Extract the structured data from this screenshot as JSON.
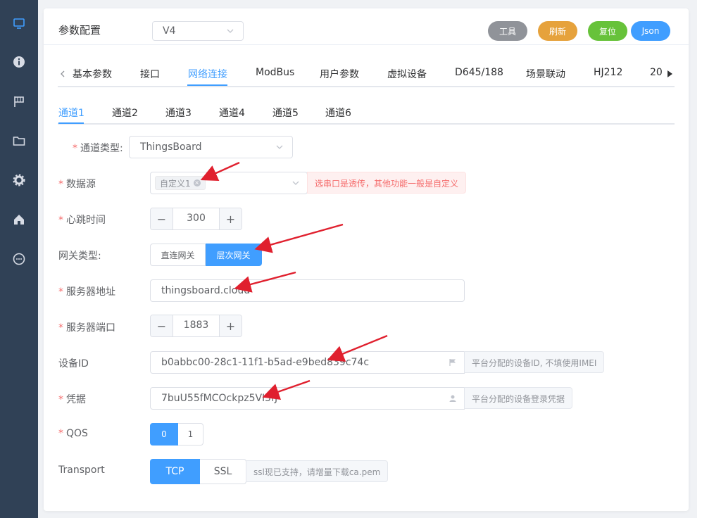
{
  "header": {
    "title": "参数配置",
    "version": "V4",
    "buttons": {
      "tools": "工具",
      "refresh": "刷新",
      "reset": "复位",
      "json": "Json"
    }
  },
  "main_tabs": [
    "基本参数",
    "接口",
    "网络连接",
    "ModBus",
    "用户参数",
    "虚拟设备",
    "D645/188",
    "场景联动",
    "HJ212",
    "20"
  ],
  "channel_tabs": [
    "通道1",
    "通道2",
    "通道3",
    "通道4",
    "通道5",
    "通道6"
  ],
  "form": {
    "channel_type": {
      "label": "通道类型:",
      "value": "ThingsBoard"
    },
    "data_source": {
      "label": "数据源",
      "tag": "自定义1",
      "hint": "选串口是透传，其他功能一般是自定义"
    },
    "heartbeat": {
      "label": "心跳时间",
      "value": "300",
      "minus": "−",
      "plus": "+"
    },
    "gateway_type": {
      "label": "网关类型:",
      "options": [
        "直连网关",
        "层次网关"
      ],
      "selected": "层次网关"
    },
    "server_addr": {
      "label": "服务器地址",
      "value": "thingsboard.cloud"
    },
    "server_port": {
      "label": "服务器端口",
      "value": "1883",
      "minus": "−",
      "plus": "+"
    },
    "device_id": {
      "label": "设备ID",
      "value": "b0abbc00-28c1-11f1-b5ad-e9bed839c74c",
      "hint": "平台分配的设备ID, 不填使用IMEI"
    },
    "credential": {
      "label": "凭据",
      "value": "7buU55fMCOckpz5VI5fJ",
      "hint": "平台分配的设备登录凭据"
    },
    "qos": {
      "label": "QOS",
      "options": [
        "0",
        "1"
      ],
      "selected": "0"
    },
    "transport": {
      "label": "Transport",
      "options": [
        "TCP",
        "SSL"
      ],
      "selected": "TCP",
      "hint": "ssl现已支持，请增量下载ca.pem"
    }
  },
  "required_mark": "*",
  "colors": {
    "primary": "#409eff",
    "sidebar": "#304156",
    "danger": "#f56c6c",
    "arrow": "#e0202e",
    "tools": "#909399",
    "refresh": "#e6a23c",
    "reset": "#67c23a"
  },
  "sidebar_icons": [
    "monitor-icon",
    "info-icon",
    "flag-icon",
    "folder-icon",
    "gear-icon",
    "home-icon",
    "chat-icon"
  ]
}
